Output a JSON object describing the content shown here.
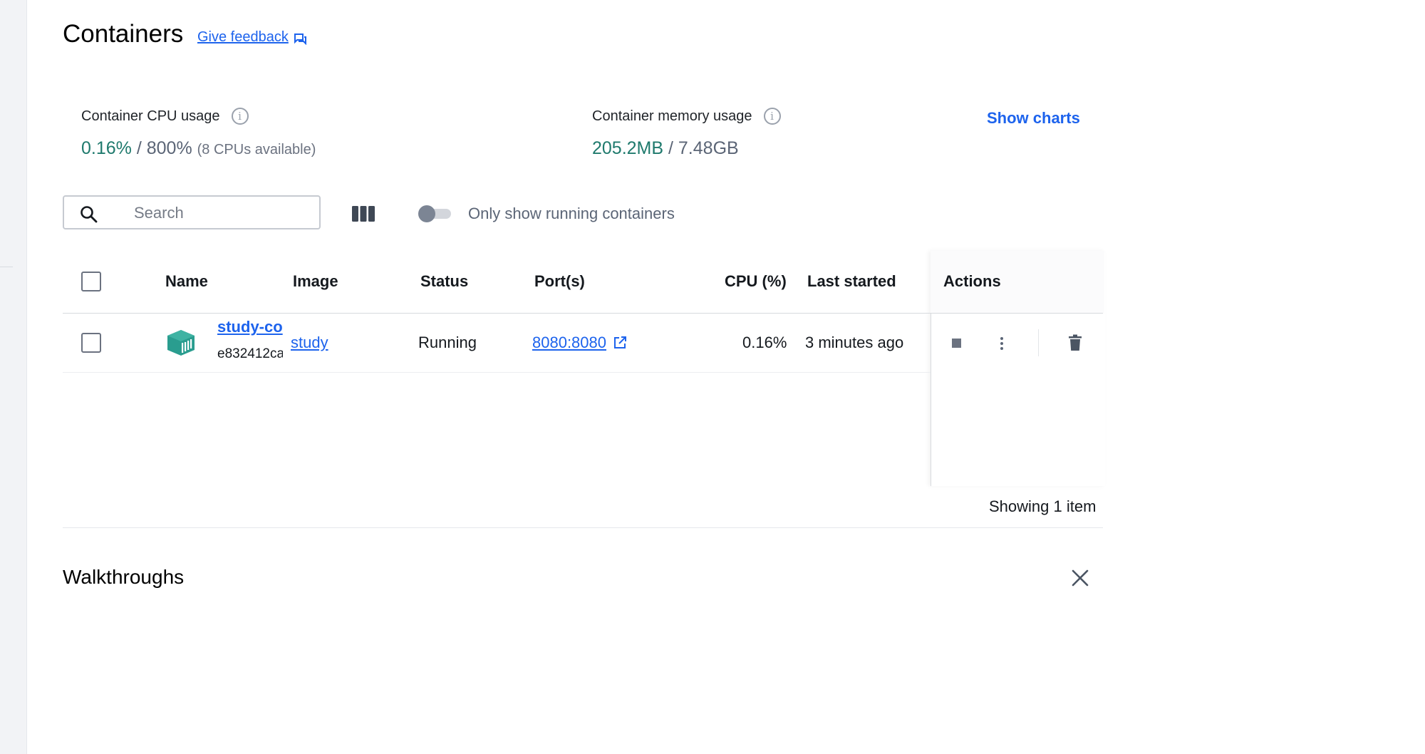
{
  "page": {
    "title": "Containers",
    "feedback_label": "Give feedback"
  },
  "stats": {
    "cpu": {
      "label": "Container CPU usage",
      "used": "0.16%",
      "separator": " / ",
      "total": "800%",
      "note": "(8 CPUs available)"
    },
    "memory": {
      "label": "Container memory usage",
      "used": "205.2MB",
      "separator": " / ",
      "total": "7.48GB"
    },
    "show_charts_label": "Show charts"
  },
  "toolbar": {
    "search_placeholder": "Search",
    "toggle_label": "Only show running containers",
    "toggle_on": false
  },
  "table": {
    "headers": {
      "name": "Name",
      "image": "Image",
      "status": "Status",
      "ports": "Port(s)",
      "cpu": "CPU (%)",
      "last_started": "Last started",
      "actions": "Actions"
    },
    "rows": [
      {
        "name": "study-co",
        "id": "e832412ca",
        "image": "study",
        "status": "Running",
        "ports": "8080:8080",
        "cpu": "0.16%",
        "last_started": "3 minutes ago"
      }
    ],
    "footer": "Showing 1 item"
  },
  "walkthroughs": {
    "title": "Walkthroughs"
  },
  "colors": {
    "accent": "#1d63ed",
    "green": "#1f7a6d",
    "container_icon": "#2a9d8f"
  },
  "icons": [
    "feedback-icon",
    "info-icon",
    "search-icon",
    "columns-icon",
    "container-icon",
    "external-link-icon",
    "stop-icon",
    "more-vert-icon",
    "trash-icon",
    "close-icon"
  ]
}
